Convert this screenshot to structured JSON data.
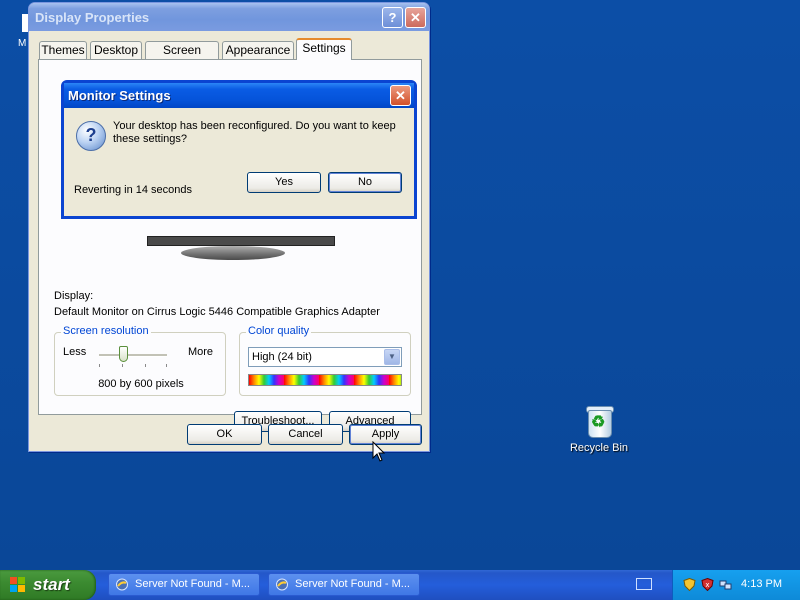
{
  "desktop": {
    "recycle_bin_label": "Recycle Bin",
    "my_computer_fragment": "M"
  },
  "display_properties": {
    "title": "Display Properties",
    "tabs": [
      {
        "label": "Themes"
      },
      {
        "label": "Desktop"
      },
      {
        "label": "Screen Saver"
      },
      {
        "label": "Appearance"
      },
      {
        "label": "Settings"
      }
    ],
    "active_tab": "Settings",
    "display_label": "Display:",
    "display_value": "Default Monitor on Cirrus Logic 5446 Compatible Graphics Adapter",
    "screen_resolution": {
      "title": "Screen resolution",
      "less_label": "Less",
      "more_label": "More",
      "value": "800 by 600 pixels"
    },
    "color_quality": {
      "title": "Color quality",
      "selected": "High (24 bit)"
    },
    "buttons": {
      "troubleshoot": "Troubleshoot...",
      "advanced": "Advanced",
      "ok": "OK",
      "cancel": "Cancel",
      "apply": "Apply"
    }
  },
  "monitor_settings_dialog": {
    "title": "Monitor Settings",
    "message": "Your desktop has been reconfigured.  Do you want to keep these settings?",
    "countdown": "Reverting in 14 seconds",
    "yes_label": "Yes",
    "no_label": "No",
    "icon": "question-icon"
  },
  "taskbar": {
    "start_label": "start",
    "items": [
      {
        "label": "Server Not Found - M..."
      },
      {
        "label": "Server Not Found - M..."
      }
    ],
    "clock": "4:13 PM"
  },
  "colors": {
    "desktop_bg": "#0a4798",
    "dialog_title_active": "#0553d9",
    "window_title_inactive": "#7196dd",
    "taskbar": "#245edb",
    "start_green": "#3c8b31",
    "tray": "#0e8ad8"
  }
}
